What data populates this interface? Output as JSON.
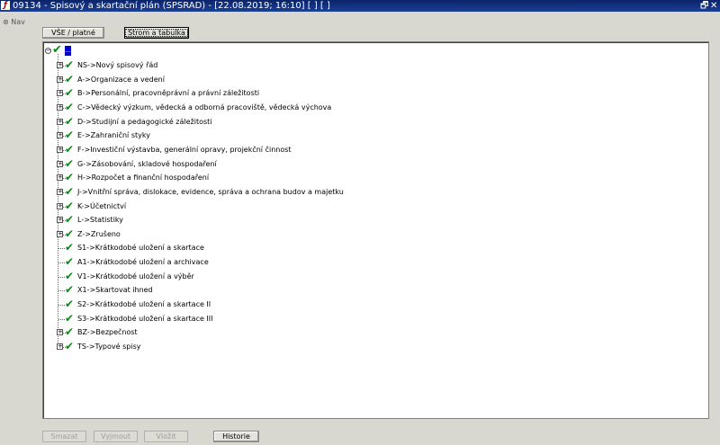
{
  "window": {
    "title": "09134 - Spisový a skartační plán (SPSRAD) - [22.08.2019; 16:10]  [ ]  [ ]",
    "app_icon": "app-logo-icon",
    "restore_glyph": "🗗",
    "close_glyph": "✕"
  },
  "nav": {
    "label": "Nav"
  },
  "toolbar": {
    "all_valid_label": "VŠE / platné",
    "tree_table_label": "Strom a tabulka"
  },
  "tree": {
    "root_label": "...",
    "items": [
      {
        "label": "NS->Nový spisový řád",
        "expandable": true
      },
      {
        "label": "A->Organizace a vedení",
        "expandable": true
      },
      {
        "label": "B->Personální, pracovněprávní a právní záležitosti",
        "expandable": true
      },
      {
        "label": "C->Vědecký výzkum, vědecká a odborná pracoviště, vědecká výchova",
        "expandable": true
      },
      {
        "label": "D->Studijní a pedagogické záležitosti",
        "expandable": true
      },
      {
        "label": "E->Zahraniční styky",
        "expandable": true
      },
      {
        "label": "F->Investiční výstavba, generální opravy, projekční činnost",
        "expandable": true
      },
      {
        "label": "G->Zásobování, skladové hospodaření",
        "expandable": true
      },
      {
        "label": "H->Rozpočet a finanční hospodaření",
        "expandable": true
      },
      {
        "label": "J->Vnitřní správa, dislokace, evidence, správa a ochrana budov a majetku",
        "expandable": true
      },
      {
        "label": "K->Účetnictví",
        "expandable": true
      },
      {
        "label": "L->Statistiky",
        "expandable": true
      },
      {
        "label": "Z->Zrušeno",
        "expandable": true
      },
      {
        "label": "S1->Krátkodobé uložení a skartace",
        "expandable": false
      },
      {
        "label": "A1->Krátkodobé uložení a archivace",
        "expandable": false
      },
      {
        "label": "V1->Krátkodobé uložení a výběr",
        "expandable": false
      },
      {
        "label": "X1->Skartovat ihned",
        "expandable": false
      },
      {
        "label": "S2->Krátkodobé uložení a skartace II",
        "expandable": false
      },
      {
        "label": "S3->Krátkodobé uložení a skartace III",
        "expandable": false
      },
      {
        "label": "BZ->Bezpečnost",
        "expandable": true
      },
      {
        "label": "TS->Typové spisy",
        "expandable": true
      }
    ]
  },
  "actions": {
    "delete_label": "Smazat",
    "cut_label": "Vyjmout",
    "paste_label": "Vložit",
    "history_label": "Historie"
  },
  "colors": {
    "titlebar": "#0a246a",
    "check": "#0b8a12",
    "selection": "#0000c8",
    "background": "#d8d8d0"
  }
}
